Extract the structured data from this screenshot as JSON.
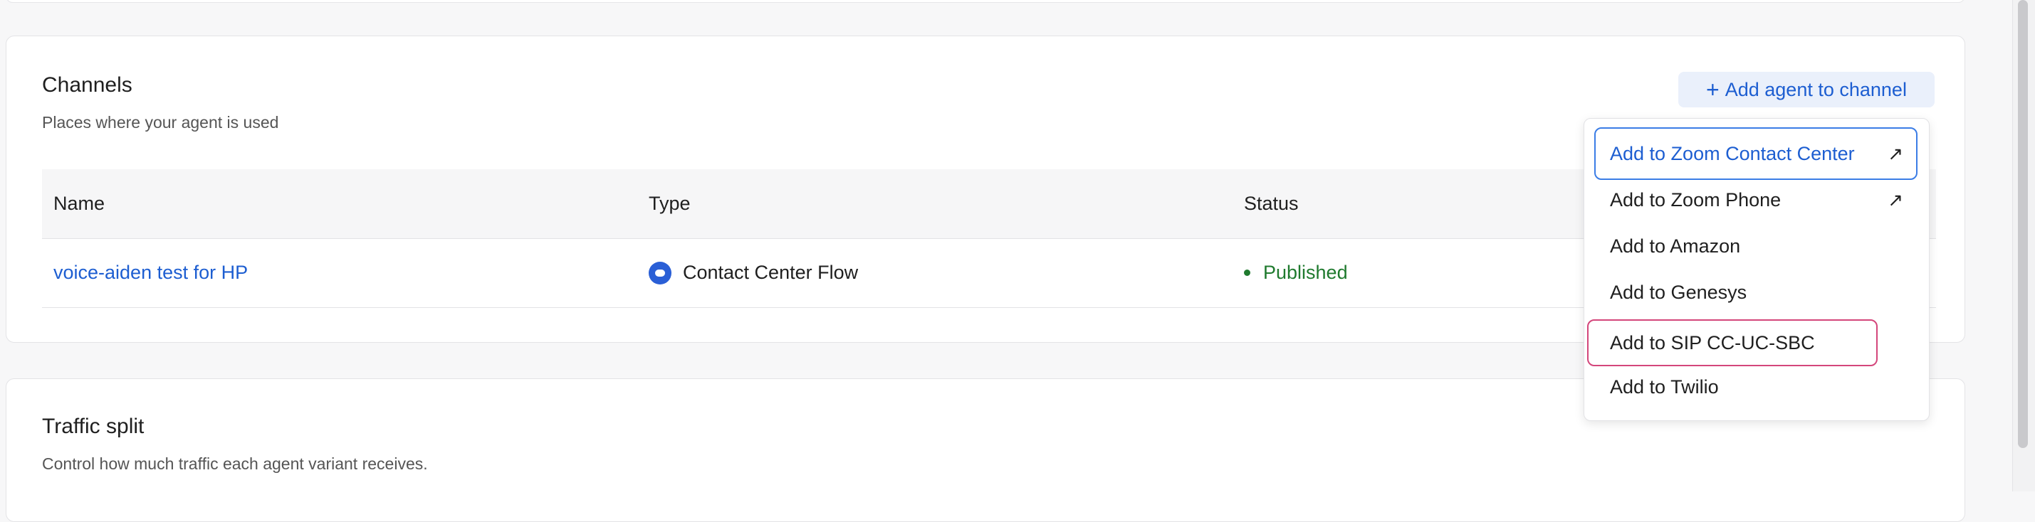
{
  "channels": {
    "title": "Channels",
    "subtitle": "Places where your agent is used",
    "add_button": {
      "icon": "plus-icon",
      "label": "Add agent to channel"
    },
    "table": {
      "headers": {
        "name": "Name",
        "type": "Type",
        "status": "Status"
      },
      "rows": [
        {
          "name": "voice-aiden test for HP",
          "type": "Contact Center Flow",
          "type_icon": "contact-center-icon",
          "status": "Published",
          "status_color": "#1f7a2e"
        }
      ]
    },
    "dropdown": {
      "items": [
        {
          "label": "Add to Zoom Contact Center",
          "external": "↗"
        },
        {
          "label": "Add to Zoom Phone",
          "external": "↗"
        },
        {
          "label": "Add to Amazon"
        },
        {
          "label": "Add to Genesys"
        },
        {
          "label": "Add to SIP CC-UC-SBC"
        },
        {
          "label": "Add to Twilio"
        }
      ]
    }
  },
  "traffic_split": {
    "title": "Traffic split",
    "subtitle": "Control how much traffic each agent variant receives."
  },
  "colors": {
    "accent": "#1d5ed1",
    "focus_ring": "#3b7de6",
    "highlight_ring": "#d4467b",
    "published": "#1f7a2e"
  }
}
